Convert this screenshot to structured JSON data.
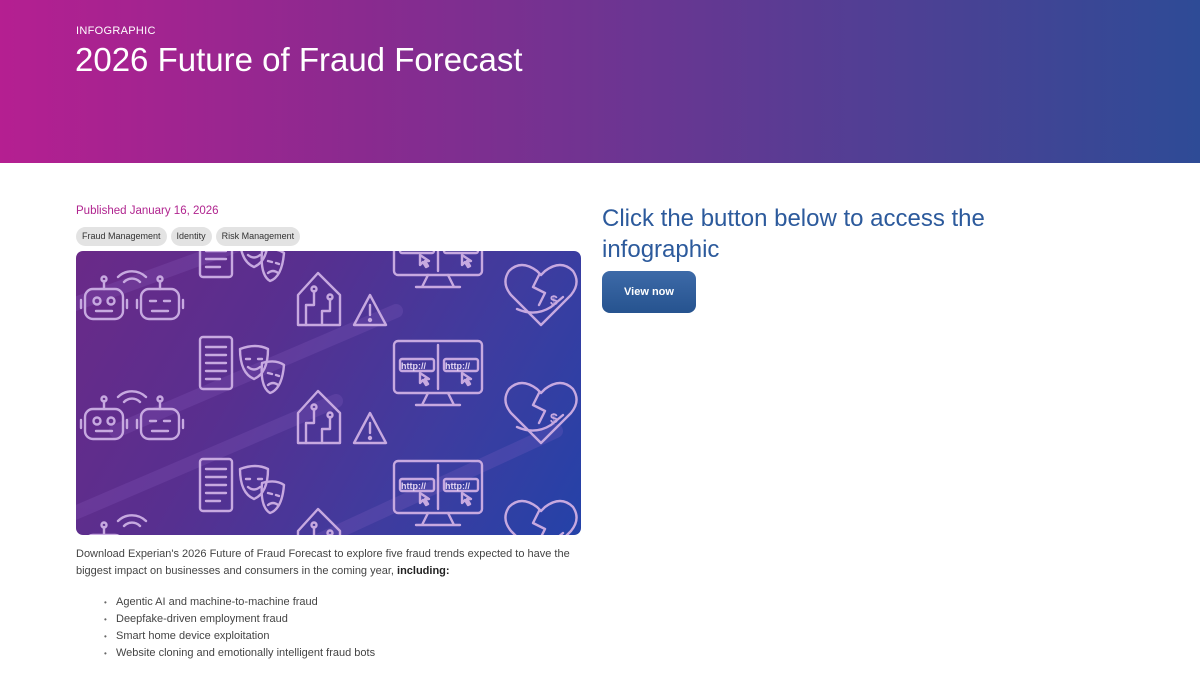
{
  "header": {
    "eyebrow": "INFOGRAPHIC",
    "title": "2026 Future of Fraud Forecast"
  },
  "article": {
    "published": "Published January 16, 2026",
    "tags": [
      "Fraud Management",
      "Identity",
      "Risk Management"
    ],
    "intro_text": "Download Experian's 2026 Future of Fraud Forecast to explore five fraud trends expected to have the biggest impact on businesses and consumers in the coming year, ",
    "intro_bold": "including:",
    "bullets": [
      "Agentic AI and machine-to-machine fraud",
      "Deepfake-driven employment fraud",
      "Smart home device exploitation",
      "Website cloning and emotionally intelligent fraud bots"
    ]
  },
  "image": {
    "url_label": "http://",
    "icons": [
      "robot-icon",
      "wifi-icon",
      "document-icon",
      "theater-masks-icon",
      "house-circuit-icon",
      "warning-icon",
      "monitor-icon",
      "broken-heart-icon",
      "dollar-icon"
    ]
  },
  "cta": {
    "heading": "Click the button below to access the infographic",
    "button_label": "View now"
  },
  "colors": {
    "hero_start": "#b51f91",
    "hero_end": "#2e4b96",
    "published_text": "#b0248f",
    "heading_blue": "#2c5a9c",
    "button_blue": "#26538f"
  }
}
